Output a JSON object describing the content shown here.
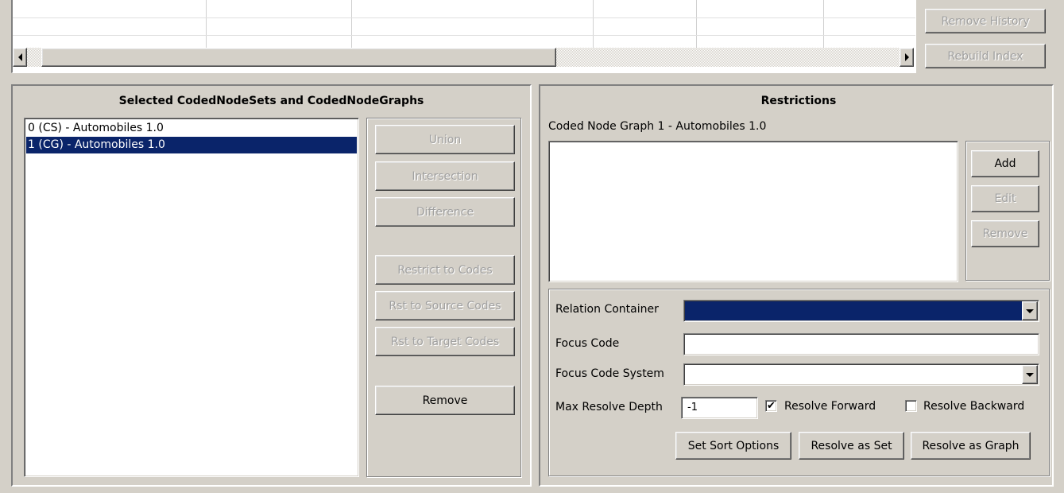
{
  "history": {
    "remove_history_label": "Remove History",
    "rebuild_index_label": "Rebuild Index"
  },
  "selected_panel": {
    "title": "Selected CodedNodeSets and CodedNodeGraphs",
    "items": [
      {
        "label": "0 (CS) - Automobiles 1.0",
        "selected": false
      },
      {
        "label": "1 (CG) - Automobiles 1.0",
        "selected": true
      }
    ],
    "buttons": {
      "union": "Union",
      "intersection": "Intersection",
      "difference": "Difference",
      "restrict_to_codes": "Restrict to Codes",
      "rst_to_source_codes": "Rst to Source Codes",
      "rst_to_target_codes": "Rst to Target Codes",
      "remove": "Remove"
    }
  },
  "restrictions": {
    "title": "Restrictions",
    "subtitle": "Coded Node Graph 1 - Automobiles 1.0",
    "buttons": {
      "add": "Add",
      "edit": "Edit",
      "remove": "Remove"
    }
  },
  "resolve": {
    "relation_container_label": "Relation Container",
    "relation_container_value": "",
    "focus_code_label": "Focus Code",
    "focus_code_value": "",
    "focus_code_system_label": "Focus Code System",
    "focus_code_system_value": "",
    "max_resolve_depth_label": "Max Resolve Depth",
    "max_resolve_depth_value": "-1",
    "resolve_forward_label": "Resolve Forward",
    "resolve_forward_checked": true,
    "resolve_backward_label": "Resolve Backward",
    "resolve_backward_checked": false,
    "set_sort_options_label": "Set Sort Options",
    "resolve_as_set_label": "Resolve as Set",
    "resolve_as_graph_label": "Resolve as Graph"
  },
  "colors": {
    "face": "#d4d0c8",
    "selection": "#0a246a",
    "disabled_text": "#a0a0a0"
  },
  "icons": {
    "scroll_left": "triangle-left",
    "scroll_right": "triangle-right",
    "dropdown": "triangle-down",
    "checkmark": "✔"
  }
}
